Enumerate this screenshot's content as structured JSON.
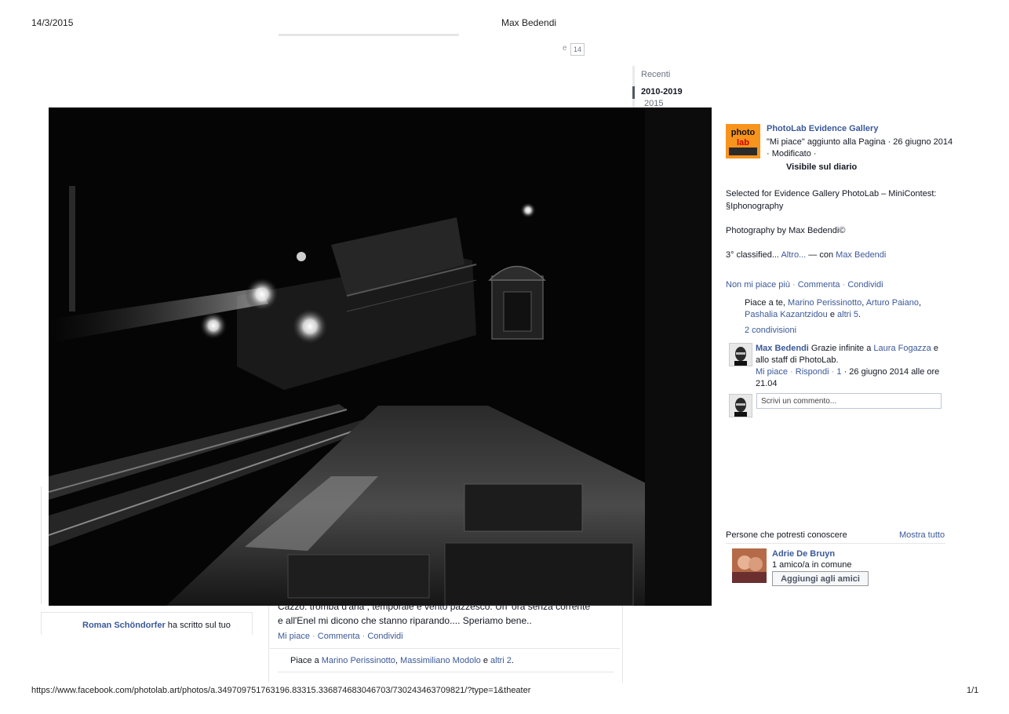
{
  "print": {
    "date": "14/3/2015",
    "title": "Max Bedendi",
    "url": "https://www.facebook.com/photolab.art/photos/a.349709751763196.83315.336874683046703/730243463709821/?type=1&theater",
    "page": "1/1"
  },
  "background": {
    "badge_prefix": "e",
    "badge_count": "14",
    "timeline": {
      "recent": "Recenti",
      "decade": "2010-2019",
      "year": "2015"
    },
    "left_card": {
      "author": "Roman Schöndorfer",
      "action": "ha scritto sul tuo"
    },
    "post": {
      "text_line1": "Cazzo: tromba d'aria , temporale e vento pazzesco. Un' ora senza corrente",
      "text_line2": "e all'Enel mi dicono che stanno riparando.... Speriamo bene..",
      "like": "Mi piace",
      "comment": "Commenta",
      "share": "Condividi",
      "likes_prefix": "Piace a",
      "liker1": "Marino Perissinotto",
      "liker2": "Massimiliano Modolo",
      "and": "e",
      "others": "altri 2",
      "end": "."
    }
  },
  "photo": {
    "icon": "night-railway-photo"
  },
  "sidebar": {
    "page_name": "PhotoLab Evidence Gallery",
    "avatar_text_top": "photo",
    "avatar_text_bottom": "lab",
    "meta": "\"Mi piace\" aggiunto alla Pagina · 26 giugno 2014 · Modificato ·",
    "visibility": "Visibile sul diario",
    "description": [
      "Selected for Evidence Gallery PhotoLab – MiniContest: §Iphonography",
      "Photography by Max Bedendi©"
    ],
    "classified": "3° classified...",
    "more": "Altro...",
    "with": "— con",
    "with_name": "Max Bedendi",
    "actions": {
      "unlike": "Non mi piace più",
      "comment": "Commenta",
      "share": "Condividi"
    },
    "likes": {
      "prefix": "Piace a te,",
      "names": [
        "Marino Perissinotto",
        "Arturo Paiano",
        "Pashalia Kazantzidou"
      ],
      "and": "e",
      "others": "altri 5",
      "end": "."
    },
    "shares": "2 condivisioni",
    "comment": {
      "author": "Max Bedendi",
      "text_a": "Grazie infinite a",
      "mention": "Laura Fogazza",
      "text_b": "e allo staff di PhotoLab.",
      "like": "Mi piace",
      "reply": "Rispondi",
      "like_count": "1",
      "time": "· 26 giugno 2014 alle ore 21.04"
    },
    "comment_placeholder": "Scrivi un commento...",
    "pymk": {
      "title": "Persone che potresti conoscere",
      "see_all": "Mostra tutto",
      "person_name": "Adrie De Bruyn",
      "mutual": "1 amico/a in comune",
      "add_button": "Aggiungi agli amici"
    }
  },
  "colors": {
    "link": "#3b5998",
    "text": "#141823",
    "photo_bg": "#000000",
    "page_avatar": "#f7941d"
  }
}
